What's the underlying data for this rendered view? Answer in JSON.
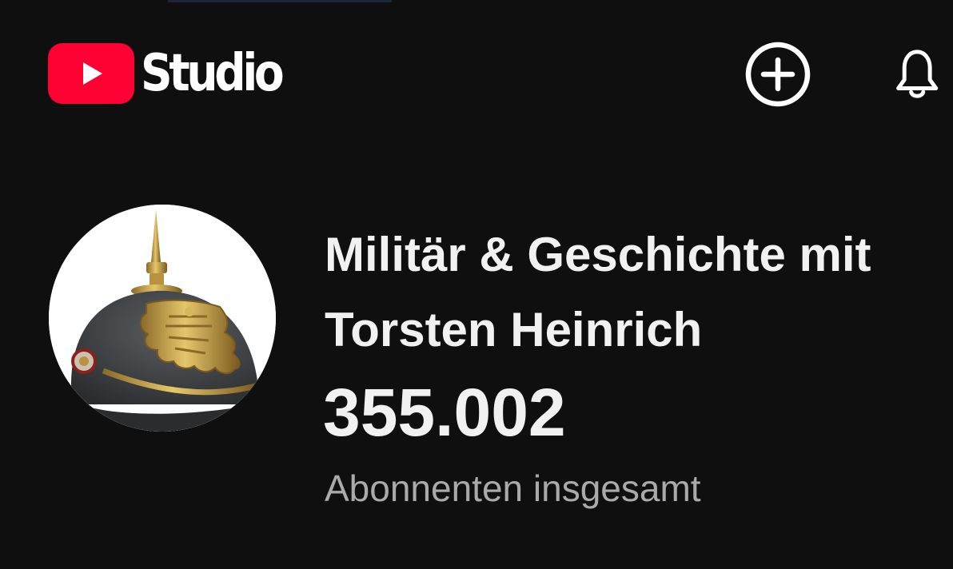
{
  "app": {
    "logo_text": "Studio",
    "logo_icon": "youtube-play-icon",
    "brand_color": "#ff0033"
  },
  "header": {
    "create_icon": "add-circle-icon",
    "notifications_icon": "bell-icon"
  },
  "channel": {
    "name": "Militär & Geschichte mit Torsten Heinrich",
    "subscriber_count": "355.002",
    "subscriber_label": "Abonnenten insgesamt",
    "avatar": "pickelhaube-helmet-image"
  },
  "colors": {
    "background": "#0f0f0f",
    "text_primary": "#f1f1f1",
    "text_secondary": "#aaaaaa"
  }
}
